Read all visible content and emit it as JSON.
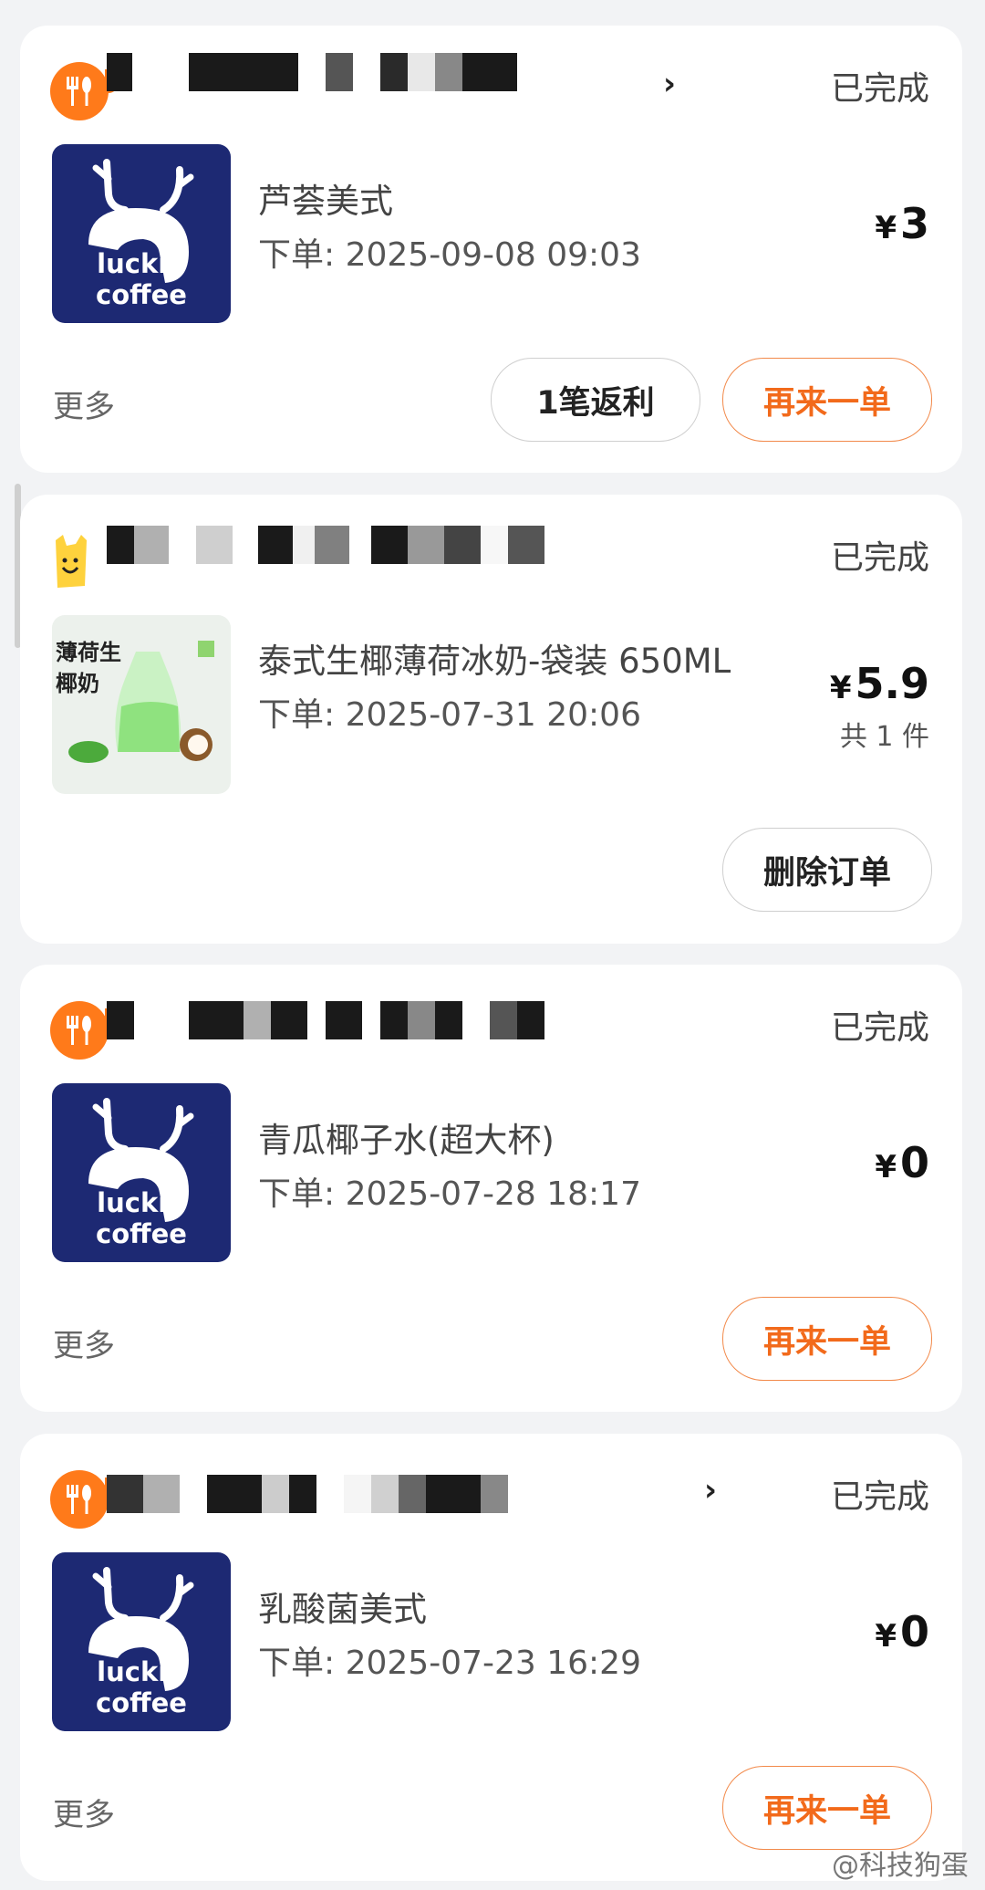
{
  "orders": [
    {
      "status": "已完成",
      "product_name": "芦荟美式",
      "order_time": "下单: 2025-09-08 09:03",
      "currency": "¥",
      "price": "3",
      "more_label": "更多",
      "buttons": [
        "1笔返利",
        "再来一单"
      ],
      "brand": "luckin coffee",
      "store_icon": "utensils-icon"
    },
    {
      "status": "已完成",
      "product_name": "泰式生椰薄荷冰奶-袋装 650ML",
      "order_time": "下单: 2025-07-31 20:06",
      "currency": "¥",
      "price": "5.9",
      "item_count": "共 1 件",
      "buttons": [
        "删除订单"
      ],
      "image_title": "薄荷生椰奶",
      "store_icon": "smiley-bag-icon"
    },
    {
      "status": "已完成",
      "product_name": "青瓜椰子水(超大杯)",
      "order_time": "下单: 2025-07-28 18:17",
      "currency": "¥",
      "price": "0",
      "more_label": "更多",
      "buttons": [
        "再来一单"
      ],
      "brand": "luckin coffee",
      "store_icon": "utensils-icon"
    },
    {
      "status": "已完成",
      "product_name": "乳酸菌美式",
      "order_time": "下单: 2025-07-23 16:29",
      "currency": "¥",
      "price": "0",
      "more_label": "更多",
      "buttons": [
        "再来一单"
      ],
      "brand": "luckin coffee",
      "store_icon": "utensils-icon"
    }
  ],
  "watermark": "@科技狗蛋",
  "colors": {
    "accent": "#f26a1b",
    "brand_blue": "#1d2973",
    "icon_orange": "#ff7a1a"
  }
}
